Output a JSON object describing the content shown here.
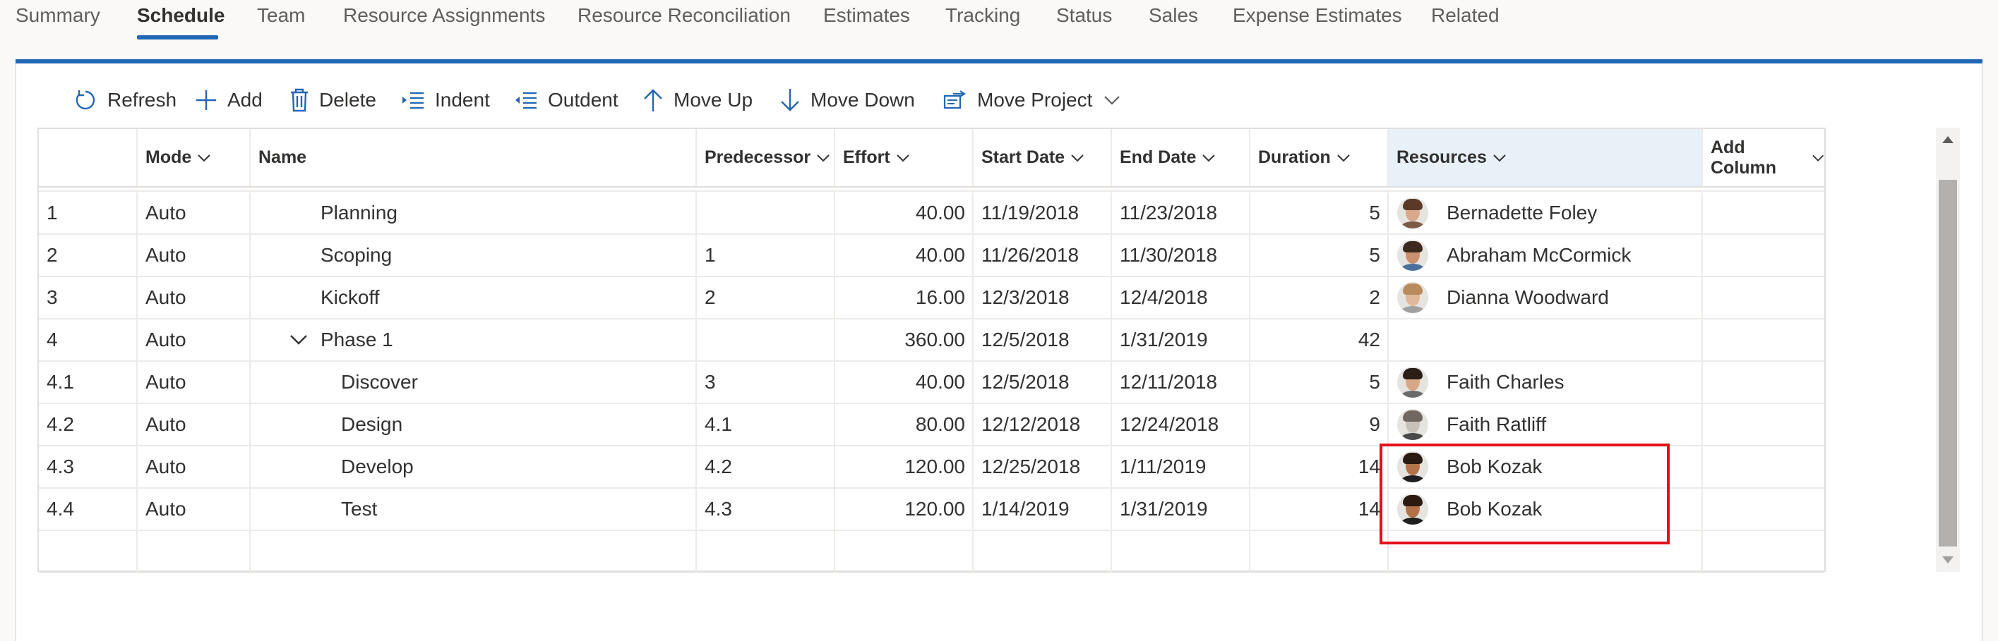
{
  "tabs": [
    {
      "label": "Summary"
    },
    {
      "label": "Schedule"
    },
    {
      "label": "Team"
    },
    {
      "label": "Resource Assignments"
    },
    {
      "label": "Resource Reconciliation"
    },
    {
      "label": "Estimates"
    },
    {
      "label": "Tracking"
    },
    {
      "label": "Status"
    },
    {
      "label": "Sales"
    },
    {
      "label": "Expense Estimates"
    },
    {
      "label": "Related"
    }
  ],
  "active_tab": "Schedule",
  "toolbar": {
    "refresh": "Refresh",
    "add": "Add",
    "delete": "Delete",
    "indent": "Indent",
    "outdent": "Outdent",
    "move_up": "Move Up",
    "move_down": "Move Down",
    "move_project": "Move Project"
  },
  "columns": {
    "mode": "Mode",
    "name": "Name",
    "predecessor": "Predecessor",
    "effort": "Effort",
    "start_date": "Start Date",
    "end_date": "End Date",
    "duration": "Duration",
    "resources": "Resources",
    "add_column": "Add Column"
  },
  "rows": [
    {
      "id": "1",
      "mode": "Auto",
      "name": "Planning",
      "predecessor": "",
      "effort": "40.00",
      "start": "11/19/2018",
      "end": "11/23/2018",
      "duration": "5",
      "resource": "Bernadette Foley"
    },
    {
      "id": "2",
      "mode": "Auto",
      "name": "Scoping",
      "predecessor": "1",
      "effort": "40.00",
      "start": "11/26/2018",
      "end": "11/30/2018",
      "duration": "5",
      "resource": "Abraham McCormick"
    },
    {
      "id": "3",
      "mode": "Auto",
      "name": "Kickoff",
      "predecessor": "2",
      "effort": "16.00",
      "start": "12/3/2018",
      "end": "12/4/2018",
      "duration": "2",
      "resource": "Dianna Woodward"
    },
    {
      "id": "4",
      "mode": "Auto",
      "name": "Phase 1",
      "predecessor": "",
      "effort": "360.00",
      "start": "12/5/2018",
      "end": "1/31/2019",
      "duration": "42",
      "resource": ""
    },
    {
      "id": "4.1",
      "mode": "Auto",
      "name": "Discover",
      "predecessor": "3",
      "effort": "40.00",
      "start": "12/5/2018",
      "end": "12/11/2018",
      "duration": "5",
      "resource": "Faith Charles"
    },
    {
      "id": "4.2",
      "mode": "Auto",
      "name": "Design",
      "predecessor": "4.1",
      "effort": "80.00",
      "start": "12/12/2018",
      "end": "12/24/2018",
      "duration": "9",
      "resource": "Faith Ratliff"
    },
    {
      "id": "4.3",
      "mode": "Auto",
      "name": "Develop",
      "predecessor": "4.2",
      "effort": "120.00",
      "start": "12/25/2018",
      "end": "1/11/2019",
      "duration": "14",
      "resource": "Bob Kozak"
    },
    {
      "id": "4.4",
      "mode": "Auto",
      "name": "Test",
      "predecessor": "4.3",
      "effort": "120.00",
      "start": "1/14/2019",
      "end": "1/31/2019",
      "duration": "14",
      "resource": "Bob Kozak"
    }
  ],
  "colors": {
    "accent": "#2266b6",
    "highlight": "#e3101b",
    "resources_header_bg": "#e8f0f8"
  }
}
